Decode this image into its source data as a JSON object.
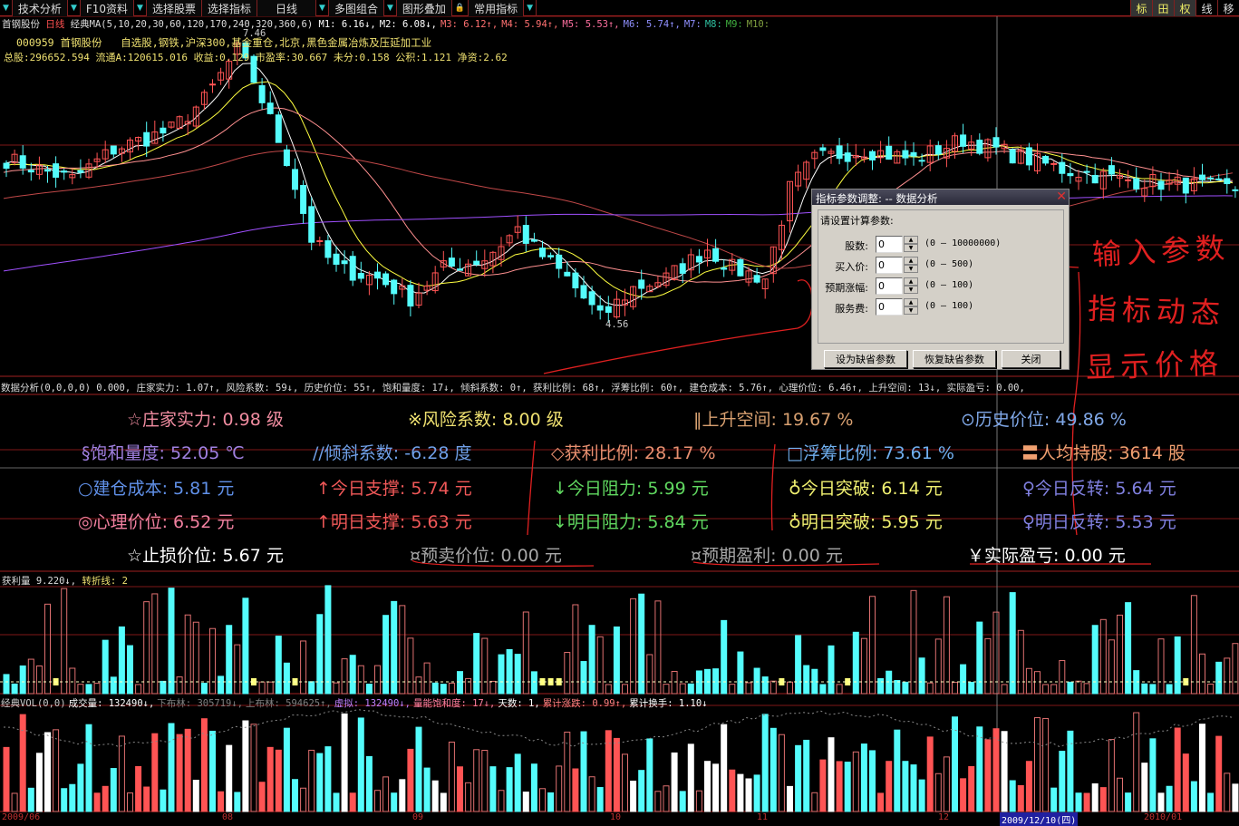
{
  "toolbar": {
    "items": [
      "技术分析",
      "F10资料",
      "选择股票",
      "选择指标",
      "日线",
      "多图组合",
      "图形叠加",
      "常用指标"
    ],
    "right_buttons": [
      "标",
      "田",
      "权",
      "线",
      "移"
    ]
  },
  "ma_line": {
    "stock": "首钢股份",
    "period": "日线",
    "indicator": "经典MA(5,10,20,30,60,120,170,240,320,360,6)",
    "values": [
      "M1: 6.16↓,",
      "M2: 6.08↓,",
      "M3: 6.12↑,",
      "M4: 5.94↑,",
      "M5: 5.53↑,",
      "M6: 5.74↑,",
      "M7:",
      "M8:",
      "M9:",
      "M10:"
    ]
  },
  "stock_info": {
    "code_name": "000959 首钢股份",
    "concepts": "自选股,钢铁,沪深300,基金重仓,北京,黑色金属冶炼及压延加工业",
    "fundamentals": "总股:296652.594  流通A:120615.016  收益:0.129  市盈率:30.667  未分:0.158  公积:1.121  净资:2.62"
  },
  "price_labels": {
    "high": "7.46",
    "low": "4.56"
  },
  "indicator_line": "数据分析(0,0,0,0) 0.000, 庄家实力: 1.07↑, 风险系数: 59↓, 历史价位: 55↑, 饱和量度: 17↓, 倾斜系数: 0↑, 获利比例: 68↑, 浮筹比例: 60↑, 建仓成本: 5.76↑, 心理价位: 6.46↑, 上升空间: 13↓, 实际盈亏: 0.00,",
  "data_panel": [
    {
      "text": "☆庄家实力: 0.98 级",
      "color": "#f08ca0"
    },
    {
      "text": "※风险系数: 8.00 级",
      "color": "#eee070"
    },
    {
      "text": "‖上升空间: 19.67 %",
      "color": "#d8a070"
    },
    {
      "text": "⊙历史价位: 49.86 %",
      "color": "#80a8e8"
    },
    {
      "text": "§饱和量度: 52.05 ℃",
      "color": "#a080e0"
    },
    {
      "text": "//倾斜系数: -6.28 度",
      "color": "#70a0e8"
    },
    {
      "text": "◇获利比例: 28.17 %",
      "color": "#e89070"
    },
    {
      "text": "□浮筹比例: 73.61 %",
      "color": "#70b0f0"
    },
    {
      "text": "〓人均持股: 3614 股",
      "color": "#f0a070"
    },
    {
      "text": "○建仓成本: 5.81 元",
      "color": "#6090e8"
    },
    {
      "text": "↑今日支撑: 5.74 元",
      "color": "#f05858"
    },
    {
      "text": "↓今日阻力: 5.99 元",
      "color": "#60d860"
    },
    {
      "text": "♁今日突破: 6.14 元",
      "color": "#f0f070"
    },
    {
      "text": "♀今日反转: 5.64 元",
      "color": "#8080e0"
    },
    {
      "text": "◎心理价位: 6.52 元",
      "color": "#f080a0"
    },
    {
      "text": "↑明日支撑: 5.63 元",
      "color": "#f05858"
    },
    {
      "text": "↓明日阻力: 5.84 元",
      "color": "#60d860"
    },
    {
      "text": "♁明日突破: 5.95 元",
      "color": "#f0f070"
    },
    {
      "text": "♀明日反转: 5.53 元",
      "color": "#8080e0"
    },
    {
      "text": "☆止损价位: 5.67 元",
      "color": "#ffffff"
    },
    {
      "text": "¤预卖价位: 0.00 元",
      "color": "#a8a8a8"
    },
    {
      "text": "¤预期盈利: 0.00 元",
      "color": "#a8a8a8"
    },
    {
      "text": "￥实际盈亏: 0.00 元",
      "color": "#ffffff"
    }
  ],
  "dialog": {
    "title": "指标参数调整: -- 数据分析",
    "prompt": "请设置计算参数:",
    "params": [
      {
        "label": "股数:",
        "value": "0",
        "range": "(0 — 10000000)"
      },
      {
        "label": "买入价:",
        "value": "0",
        "range": "(0 — 500)"
      },
      {
        "label": "预期涨幅:",
        "value": "0",
        "range": "(0 — 100)"
      },
      {
        "label": "服务费:",
        "value": "0",
        "range": "(0 — 100)"
      }
    ],
    "buttons": [
      "设为缺省参数",
      "恢复缺省参数",
      "关闭"
    ]
  },
  "annotations": [
    "输入参数",
    "指标动态",
    "显示价格"
  ],
  "profit_panel": {
    "name": "获利量",
    "value": "9.220↓,",
    "turn_label": "转折线: 2"
  },
  "volume_panel": {
    "items": [
      {
        "text": "经典VOL(0,0)",
        "color": "#cccccc"
      },
      {
        "text": "成交量: 132490↓,",
        "color": "#ffffff"
      },
      {
        "text": "下布林: 305719↓,",
        "color": "#808080"
      },
      {
        "text": "上布林: 594625↑,",
        "color": "#808080"
      },
      {
        "text": "虚拟: 132490↓,",
        "color": "#c080ff"
      },
      {
        "text": "量能饱和度: 17↓,",
        "color": "#ff80a0"
      },
      {
        "text": "天数: 1,",
        "color": "#ffffff"
      },
      {
        "text": "累计涨跌: 0.99↑,",
        "color": "#ff8080"
      },
      {
        "text": "累计换手: 1.10↓",
        "color": "#ffffff"
      }
    ]
  },
  "date_axis": [
    "2009/06",
    "08",
    "09",
    "10",
    "11",
    "12",
    "2009/12/10(四)",
    "2010/01"
  ],
  "colors": {
    "up": "#ff5454",
    "down": "#54fcfc",
    "grid": "#801818"
  },
  "chart_data": {
    "type": "candlestick",
    "price_keyframes": [
      [
        0,
        6.2
      ],
      [
        8,
        6.0
      ],
      [
        13,
        6.3
      ],
      [
        20,
        6.5
      ],
      [
        24,
        6.8
      ],
      [
        28,
        7.3
      ],
      [
        30,
        7.0
      ],
      [
        34,
        6.2
      ],
      [
        37,
        5.4
      ],
      [
        40,
        5.1
      ],
      [
        45,
        5.0
      ],
      [
        49,
        4.8
      ],
      [
        53,
        5.1
      ],
      [
        58,
        5.2
      ],
      [
        62,
        5.5
      ],
      [
        64,
        5.3
      ],
      [
        68,
        5.0
      ],
      [
        72,
        4.6
      ],
      [
        76,
        4.9
      ],
      [
        80,
        5.0
      ],
      [
        85,
        5.3
      ],
      [
        88,
        5.1
      ],
      [
        92,
        5.0
      ],
      [
        95,
        5.9
      ],
      [
        98,
        6.2
      ],
      [
        104,
        6.3
      ],
      [
        110,
        6.2
      ],
      [
        116,
        6.4
      ],
      [
        124,
        6.2
      ],
      [
        128,
        6.1
      ],
      [
        135,
        6.0
      ],
      [
        149,
        5.9
      ]
    ],
    "ylim": [
      4.56,
      7.46
    ]
  }
}
